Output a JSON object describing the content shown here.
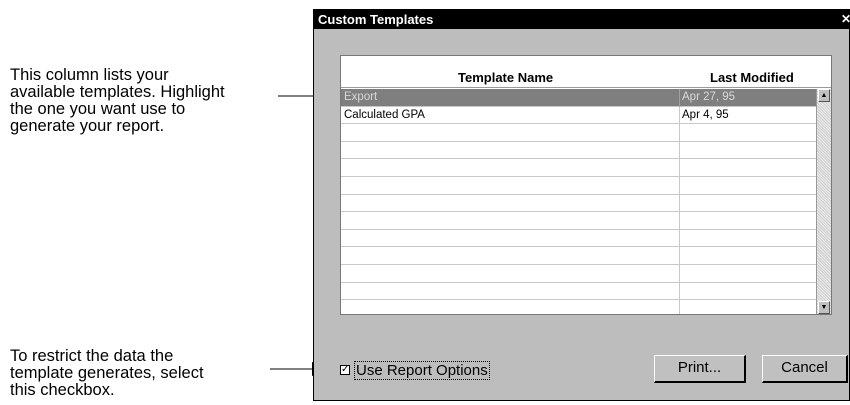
{
  "annotations": {
    "top": [
      "This column lists your",
      "available templates. Highlight",
      "the one you want use to",
      "generate your report."
    ],
    "bottom": [
      "To restrict the data the",
      "template generates, select",
      "this checkbox."
    ]
  },
  "dialog": {
    "title": "Custom Templates",
    "close_glyph": "✕",
    "columns": {
      "name": "Template Name",
      "modified": "Last Modified"
    },
    "rows": [
      {
        "name": "Export",
        "modified": "Apr 27, 95",
        "selected": true
      },
      {
        "name": "Calculated GPA",
        "modified": "Apr 4, 95",
        "selected": false
      },
      {
        "name": "",
        "modified": "",
        "selected": false
      },
      {
        "name": "",
        "modified": "",
        "selected": false
      },
      {
        "name": "",
        "modified": "",
        "selected": false
      },
      {
        "name": "",
        "modified": "",
        "selected": false
      },
      {
        "name": "",
        "modified": "",
        "selected": false
      },
      {
        "name": "",
        "modified": "",
        "selected": false
      },
      {
        "name": "",
        "modified": "",
        "selected": false
      },
      {
        "name": "",
        "modified": "",
        "selected": false
      },
      {
        "name": "",
        "modified": "",
        "selected": false
      },
      {
        "name": "",
        "modified": "",
        "selected": false
      },
      {
        "name": "",
        "modified": "",
        "selected": false
      }
    ],
    "checkbox": {
      "label": "Use Report Options",
      "checked": true,
      "glyph": "✓"
    },
    "buttons": {
      "print": "Print...",
      "cancel": "Cancel"
    },
    "scroll_icons": {
      "up": "▲",
      "down": "▼"
    }
  }
}
